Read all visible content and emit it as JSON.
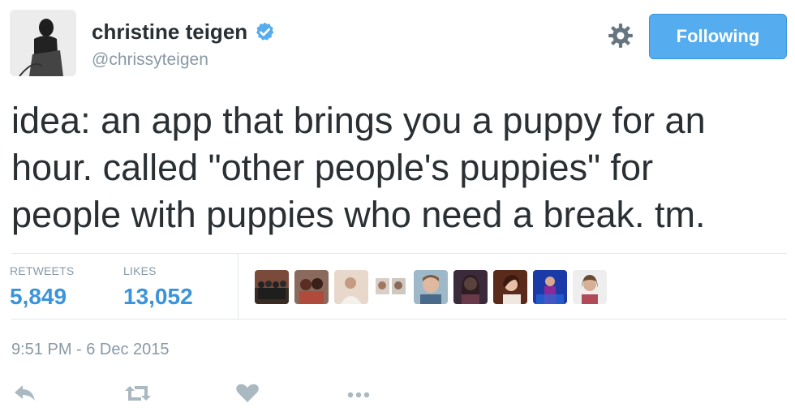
{
  "author": {
    "display_name": "christine teigen",
    "handle": "@chrissyteigen",
    "verified": true
  },
  "follow_button": {
    "label": "Following"
  },
  "tweet": {
    "text_lines": [
      "idea: an app that brings you a puppy for an",
      "hour. called \"other people's puppies\" for",
      "people with puppies who need a break. tm."
    ]
  },
  "stats": {
    "retweets_label": "RETWEETS",
    "retweets_value": "5,849",
    "likes_label": "LIKES",
    "likes_value": "13,052"
  },
  "timestamp": "9:51 PM - 6 Dec 2015",
  "colors": {
    "accent": "#55acee",
    "link": "#3b94d9",
    "muted": "#8899a6",
    "text": "#292f33",
    "icon_muted": "#aab8c2"
  },
  "icons": {
    "verified": "verified-badge-icon",
    "settings": "gear-icon",
    "reply": "reply-icon",
    "retweet": "retweet-icon",
    "like": "heart-icon",
    "more": "more-dots-icon"
  }
}
